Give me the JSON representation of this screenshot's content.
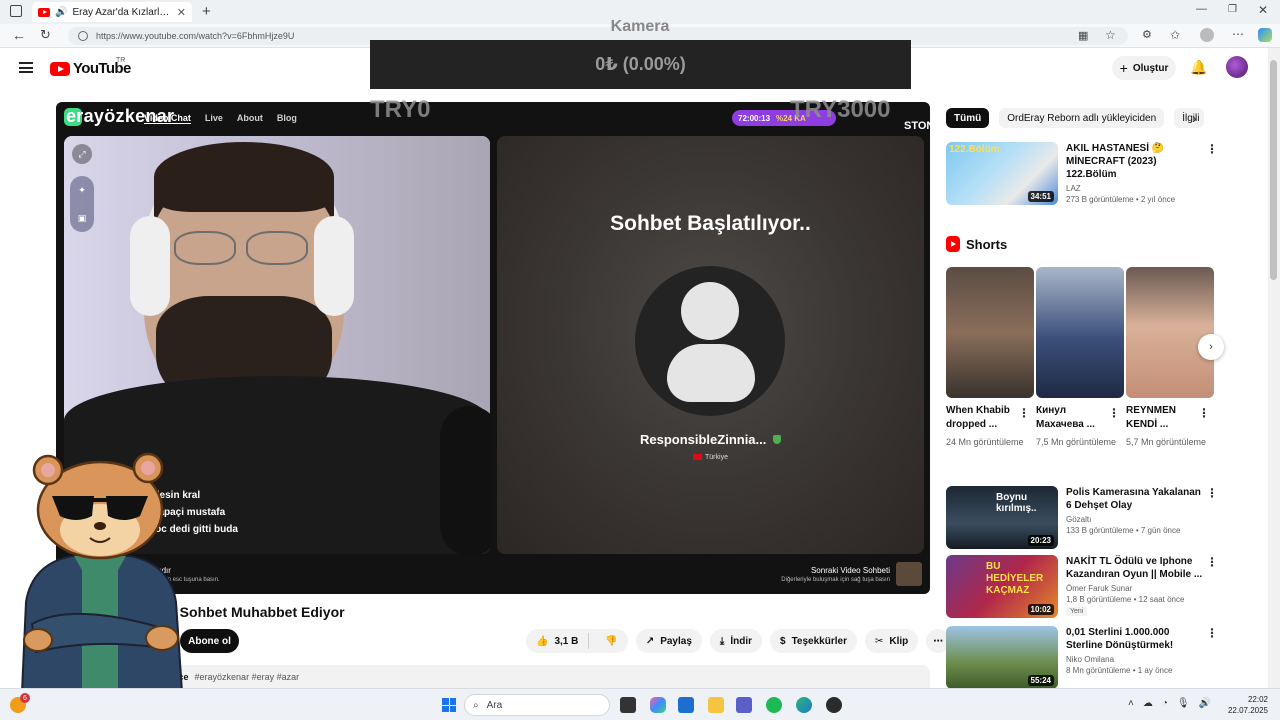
{
  "browser": {
    "tab_title": "Eray Azar'da Kızlarla Sohbet...",
    "url": "https://www.youtube.com/watch?v=6FbhmHjze9U"
  },
  "youtube": {
    "logo_text": "YouTube",
    "country_code": "TR",
    "create_label": "Oluştur"
  },
  "overlay": {
    "camera_label": "Kamera",
    "amount": "0₺ (0.00%)",
    "try_left": "TRY0",
    "try_right": "TRY3000"
  },
  "player": {
    "brand": "erayözkenar",
    "nav": [
      "Video Chat",
      "Live",
      "About",
      "Blog"
    ],
    "timer": "72:00:13",
    "timer_extra": "%24 KA",
    "coins": "STONERS",
    "chat": [
      "ardesin kral",
      "a : apaçi mustafa",
      "si oc dedi gitti buda"
    ],
    "right_title": "Sohbet Başlatılıyor..",
    "username": "ResponsibleZinnia...",
    "country": "Türkiye",
    "footer_left": "anlandır",
    "footer_left_sub": "dırmak için esc tuşuna basın.",
    "footer_right": "Sonraki Video Sohbeti",
    "footer_right_sub": "Diğerleriyle buluşmak için sağ tuşa basın"
  },
  "video": {
    "title": "a Sohbet Muhabbet Ediyor",
    "subscribe": "Abone ol",
    "likes": "3,1 B",
    "share": "Paylaş",
    "download": "İndir",
    "thanks": "Teşekkürler",
    "clip": "Klip",
    "desc_age": "ay önce",
    "desc_tags": "#erayözkenar #eray #azar"
  },
  "sidebar": {
    "chips": [
      "Tümü",
      "OrdEray Reborn adlı yükleyiciden",
      "İlgili"
    ],
    "top_rec": {
      "title": "AKIL HASTANESİ 🤔 MİNECRAFT (2023) 122.Bölüm",
      "channel": "LAZ",
      "meta": "273 B görüntüleme • 2 yıl önce",
      "duration": "34:51",
      "thumb_text": "122.Bölüm"
    },
    "shorts_label": "Shorts",
    "shorts": [
      {
        "title": "When Khabib dropped ...",
        "views": "24 Mn görüntüleme"
      },
      {
        "title": "Кинул Махачева ...",
        "views": "7,5 Mn görüntüleme"
      },
      {
        "title": "REYNMEN KENDİ ...",
        "views": "5,7 Mn görüntüleme"
      }
    ],
    "recs": [
      {
        "title": "Polis Kamerasına Yakalanan 6 Dehşet Olay",
        "channel": "Gözaltı",
        "meta": "133 B görüntüleme • 7 gün önce",
        "duration": "20:23",
        "thumb_text": "Boynu kırılmış..",
        "badge": ""
      },
      {
        "title": "NAKİT TL Ödülü ve Iphone Kazandıran Oyun || Mobile ...",
        "channel": "Ömer Faruk Sunar",
        "meta": "1,8 B görüntüleme • 12 saat önce",
        "duration": "10:02",
        "thumb_text": "BU HEDİYELER KAÇMAZ",
        "badge": "Yeni"
      },
      {
        "title": "0,01 Sterlini 1.000.000 Sterline Dönüştürmek!",
        "channel": "Niko Omilana",
        "meta": "8 Mn görüntüleme • 1 ay önce",
        "duration": "55:24",
        "thumb_text": "",
        "badge": ""
      }
    ]
  },
  "taskbar": {
    "search_placeholder": "Ara",
    "time": "22:02",
    "date": "22.07.2025",
    "notif_count": "6"
  },
  "colors": {
    "youtube_red": "#ff0000",
    "timer_purple": "#8e3de0",
    "overlay_bar": "#232323"
  }
}
